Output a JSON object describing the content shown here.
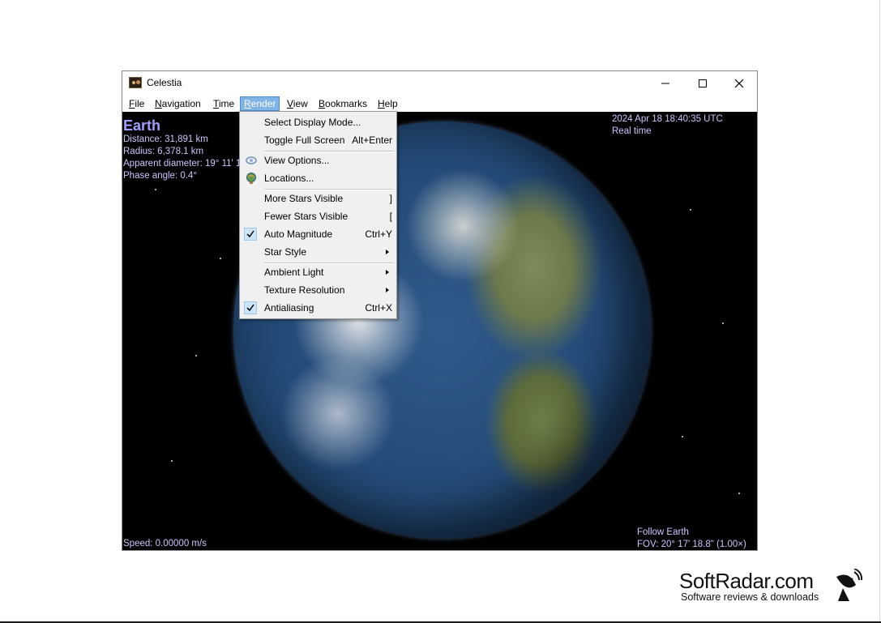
{
  "window": {
    "title": "Celestia"
  },
  "menubar": {
    "items": [
      {
        "label": "File",
        "ul": "F",
        "rest": "ile"
      },
      {
        "label": "Navigation",
        "ul": "N",
        "rest": "avigation"
      },
      {
        "label": "Time",
        "ul": "T",
        "rest": "ime"
      },
      {
        "label": "Render",
        "ul": "R",
        "rest": "ender"
      },
      {
        "label": "View",
        "ul": "V",
        "rest": "iew"
      },
      {
        "label": "Bookmarks",
        "ul": "B",
        "rest": "ookmarks"
      },
      {
        "label": "Help",
        "ul": "H",
        "rest": "elp"
      }
    ]
  },
  "hud": {
    "object_name": "Earth",
    "distance": "Distance: 31,891 km",
    "radius": "Radius: 6,378.1 km",
    "apparent_diameter": "Apparent diameter: 19° 11' 1",
    "phase_angle": "Phase angle: 0.4°",
    "datetime": "2024 Apr 18 18:40:35 UTC",
    "time_mode": "Real time",
    "speed": "Speed: 0.00000 m/s",
    "follow": "Follow Earth",
    "fov": "FOV: 20° 17' 18.8\" (1.00×)"
  },
  "render_menu": {
    "items": [
      {
        "label": "Select Display Mode...",
        "shortcut": ""
      },
      {
        "label": "Toggle Full Screen",
        "shortcut": "Alt+Enter"
      },
      {
        "label": "View Options...",
        "shortcut": "",
        "icon": "view-options-icon"
      },
      {
        "label": "Locations...",
        "shortcut": "",
        "icon": "locations-globe-icon"
      },
      {
        "label": "More Stars Visible",
        "shortcut": "]"
      },
      {
        "label": "Fewer Stars Visible",
        "shortcut": "["
      },
      {
        "label": "Auto Magnitude",
        "shortcut": "Ctrl+Y",
        "checked": true
      },
      {
        "label": "Star Style",
        "submenu": true
      },
      {
        "label": "Ambient Light",
        "submenu": true
      },
      {
        "label": "Texture Resolution",
        "submenu": true
      },
      {
        "label": "Antialiasing",
        "shortcut": "Ctrl+X",
        "checked": true
      }
    ]
  },
  "watermark": {
    "title": "SoftRadar.com",
    "subtitle": "Software reviews & downloads"
  },
  "colors": {
    "hud_text": "#c8c8ff",
    "menu_highlight": "#7fb4e6",
    "check_bg": "#cce4f7"
  }
}
